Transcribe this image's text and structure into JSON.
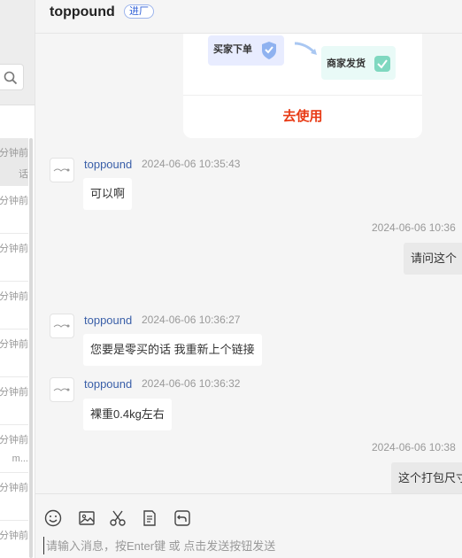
{
  "header": {
    "title": "toppound",
    "tag": "进厂"
  },
  "sidebar": {
    "items": [
      {
        "time": "分钟前",
        "sub": "话",
        "active": true
      },
      {
        "time": "分钟前",
        "sub": ""
      },
      {
        "time": "分钟前",
        "sub": ""
      },
      {
        "time": "分钟前",
        "sub": ""
      },
      {
        "time": "分钟前",
        "sub": ""
      },
      {
        "time": "分钟前",
        "sub": ""
      },
      {
        "time": "分钟前",
        "sub": "m..."
      },
      {
        "time": "分钟前",
        "sub": ""
      },
      {
        "time": "分钟前",
        "sub": ""
      }
    ]
  },
  "card": {
    "buyer_step": "买家下单",
    "seller_step": "商家发货",
    "action": "去使用"
  },
  "messages": [
    {
      "side": "left",
      "sender": "toppound",
      "time": "2024-06-06 10:35:43",
      "text": "可以啊"
    },
    {
      "side": "right",
      "time": "2024-06-06 10:36",
      "text": "请问这个"
    },
    {
      "side": "left",
      "sender": "toppound",
      "time": "2024-06-06 10:36:27",
      "text": "您要是零买的话  我重新上个链接"
    },
    {
      "side": "left",
      "sender": "toppound",
      "time": "2024-06-06 10:36:32",
      "text": "裸重0.4kg左右"
    },
    {
      "side": "right",
      "time": "2024-06-06 10:38",
      "text": "这个打包尺寸"
    }
  ],
  "composer": {
    "placeholder": "请输入消息，按Enter键 或 点击发送按钮发送"
  },
  "colors": {
    "accent": "#e83a14",
    "sender": "#3a5fa8",
    "tag": "#2b5cd6"
  }
}
